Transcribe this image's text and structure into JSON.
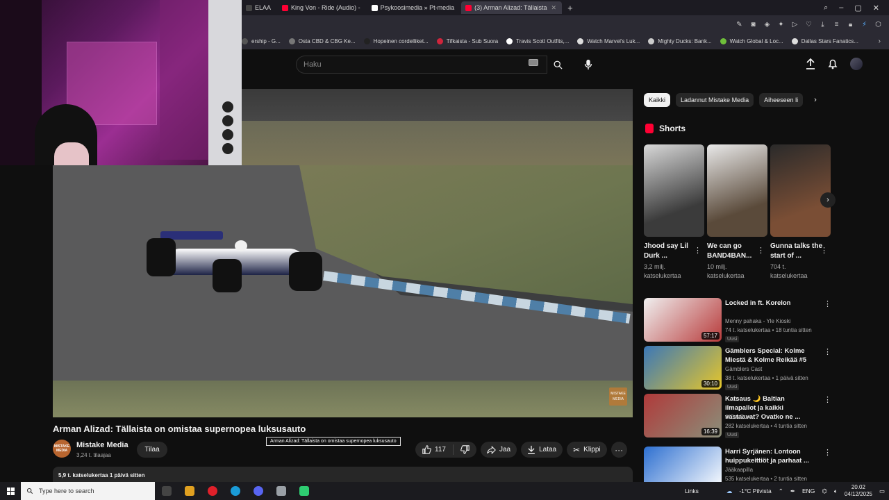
{
  "browser": {
    "tabs": [
      {
        "label": "ELAA",
        "fav_color": "#444444",
        "active": false
      },
      {
        "label": "King Von - Ride (Audio) -",
        "fav_color": "#ff0033",
        "active": false
      },
      {
        "label": "Psykoosimedia » Pt-media",
        "fav_color": "#ffffff",
        "active": false
      },
      {
        "label": "(3) Arman Alizad: Tällaista",
        "fav_color": "#ff0033",
        "active": true
      }
    ],
    "new_tab": "+",
    "bookmarks": [
      {
        "label": "ership - G...",
        "color": "#555555"
      },
      {
        "label": "Osta CBD & CBG Ke...",
        "color": "#777777"
      },
      {
        "label": "Hopeinen cordelliket...",
        "color": "#222222"
      },
      {
        "label": "Tifkaista - Sub Suora",
        "color": "#d0253c"
      },
      {
        "label": "Travis Scott Outfits,...",
        "color": "#ffffff"
      },
      {
        "label": "Watch Marvel's Luk...",
        "color": "#dddddd"
      },
      {
        "label": "Mighty Ducks: Bank...",
        "color": "#cccccc"
      },
      {
        "label": "Watch Global & Loc...",
        "color": "#6fbf3a"
      },
      {
        "label": "Dallas Stars Fanatics...",
        "color": "#dddddd"
      }
    ],
    "bookmarks_more": "›"
  },
  "youtube": {
    "search_placeholder": "Haku",
    "video": {
      "title": "Arman Alizad: Tällaista on omistaa supernopea luksusauto",
      "tooltip": "Arman Alizad: Tällaista on omistaa supernopea luksusauto",
      "watermark": "MISTAKE MEDIA",
      "channel": "Mistake Media",
      "channel_avatar_text": "MISTAKE MEDIA",
      "subscribers": "3,24 t. tilaajaa",
      "subscribe": "Tilaa",
      "likes": "117",
      "share": "Jaa",
      "download": "Lataa",
      "clip": "Klippi",
      "more": "···",
      "description_meta": "5,9 t. katselukertaa  1 päivä sitten"
    },
    "chips": [
      {
        "label": "Kaikki",
        "active": true
      },
      {
        "label": "Ladannut Mistake Media",
        "active": false
      },
      {
        "label": "Aiheeseen li",
        "active": false
      }
    ],
    "shorts_heading": "Shorts",
    "shorts": [
      {
        "title": "Jhood say Lil Durk ...",
        "views": "3,2 milj. katselukertaa",
        "c1": "#d8d8d8",
        "c2": "#3b3b3b"
      },
      {
        "title": "We can go BAND4BAN...",
        "views": "10 milj. katselukertaa",
        "c1": "#e9e9e9",
        "c2": "#5a4a3a"
      },
      {
        "title": "Gunna talks the start of ...",
        "views": "704 t. katselukertaa",
        "c1": "#2a2a2a",
        "c2": "#7a4e35"
      }
    ],
    "recommendations": [
      {
        "title": "Locked in ft. Korelon",
        "channel": "Menny pahaka - Yle Kioski",
        "meta": "74 t. katselukertaa • 18 tuntia sitten",
        "badge": "Uusi",
        "duration": "57:17",
        "c1": "#f0f0f0",
        "c2": "#b83b3b"
      },
      {
        "title": "Gämblers Special: Kolme Miestä & Kolme Reikää #5",
        "channel": "Gämblers Cast",
        "meta": "38 t. katselukertaa • 1 päivä sitten",
        "badge": "Uusi",
        "duration": "30:10",
        "c1": "#3a77b8",
        "c2": "#e6c62a"
      },
      {
        "title": "Katsaus 🌙 Baltian ilmapallot ja kaikki vastaavat? Ovatko ne ...",
        "channel": "JiiPeePuro",
        "meta": "282 katselukertaa • 4 tuntia sitten",
        "badge": "Uusi",
        "duration": "16:39",
        "c1": "#b03a3a",
        "c2": "#8a8f7a"
      },
      {
        "title": "Harri Syrjänen: Lontoon huippukeittiöt ja parhaat ...",
        "channel": "Jääkaapilla",
        "meta": "535 katselukertaa • 2 tuntia sitten",
        "badge": "",
        "duration": "",
        "c1": "#2d6fd0",
        "c2": "#ffffff"
      }
    ]
  },
  "taskbar": {
    "search_placeholder": "Type here to search",
    "links": "Links",
    "weather": "-1°C  Pilvista",
    "lang": "ENG",
    "time": "20.02",
    "date": "04/12/2025",
    "apps": [
      {
        "name": "task-view",
        "color": "#444444"
      },
      {
        "name": "multicolor-app",
        "color": "#e0a020"
      },
      {
        "name": "opera",
        "color": "#e0202a"
      },
      {
        "name": "edge",
        "color": "#1a9bd7"
      },
      {
        "name": "discord",
        "color": "#5865f2"
      },
      {
        "name": "shield-app",
        "color": "#9aa0a6"
      },
      {
        "name": "green-app",
        "color": "#2ecc71"
      }
    ]
  }
}
